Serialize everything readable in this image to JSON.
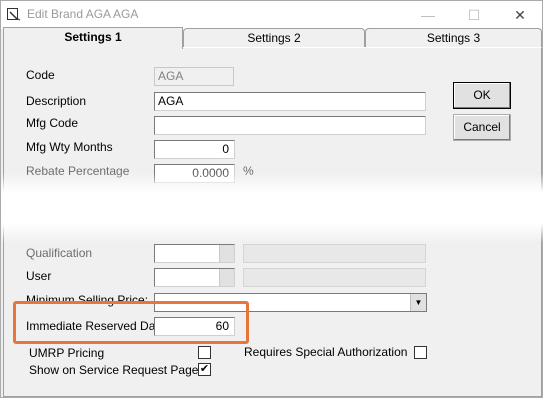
{
  "window": {
    "title": "Edit Brand AGA AGA",
    "minimize": "—",
    "maximize": "☐",
    "close": "✕"
  },
  "tabs": [
    {
      "label": "Settings 1",
      "active": true
    },
    {
      "label": "Settings 2",
      "active": false
    },
    {
      "label": "Settings 3",
      "active": false
    }
  ],
  "fields": {
    "code": {
      "label": "Code",
      "value": "AGA"
    },
    "description": {
      "label": "Description",
      "value": "AGA"
    },
    "mfg_code": {
      "label": "Mfg Code",
      "value": ""
    },
    "mfg_wty_months": {
      "label": "Mfg Wty Months",
      "value": "0"
    },
    "rebate_percentage": {
      "label": "Rebate Percentage",
      "value": "0.0000",
      "unit": "%"
    },
    "qualification": {
      "label": "Qualification",
      "value": ""
    },
    "user": {
      "label": "User",
      "value": ""
    },
    "minimum_selling_price": {
      "label": "Minimum Selling Price:",
      "value": ""
    },
    "immediate_reserved_days": {
      "label": "Immediate Reserved Days",
      "value": "60"
    }
  },
  "checkboxes": {
    "umrp_pricing": {
      "label": "UMRP Pricing",
      "checked": false
    },
    "requires_special_authorization": {
      "label": "Requires Special Authorization",
      "checked": false
    },
    "show_on_service_request_page": {
      "label": "Show on Service Request Page",
      "checked": true
    }
  },
  "buttons": {
    "ok": "OK",
    "cancel": "Cancel"
  },
  "colors": {
    "highlight": "#e8763a",
    "window_bg": "#f0f0f0"
  }
}
